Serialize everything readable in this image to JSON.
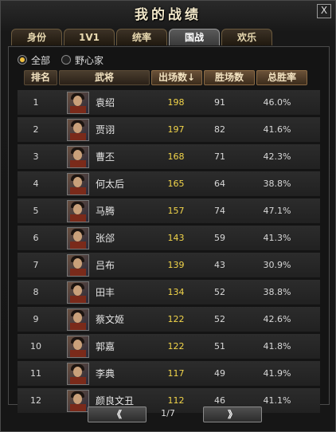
{
  "window": {
    "title": "我的战绩",
    "close_label": "X"
  },
  "tabs": [
    {
      "label": "身份",
      "active": false
    },
    {
      "label": "1V1",
      "active": false
    },
    {
      "label": "统率",
      "active": false
    },
    {
      "label": "国战",
      "active": true
    },
    {
      "label": "欢乐",
      "active": false
    }
  ],
  "filters": [
    {
      "label": "全部",
      "selected": true
    },
    {
      "label": "野心家",
      "selected": false
    }
  ],
  "columns": {
    "rank": "排名",
    "general": "武将",
    "games": "出场数",
    "games_sort_icon": "sort-down-arrow-icon",
    "wins": "胜场数",
    "win_rate": "总胜率"
  },
  "rows": [
    {
      "rank": "1",
      "name": "袁绍",
      "games": "198",
      "wins": "91",
      "rate": "46.0%"
    },
    {
      "rank": "2",
      "name": "贾诩",
      "games": "197",
      "wins": "82",
      "rate": "41.6%"
    },
    {
      "rank": "3",
      "name": "曹丕",
      "games": "168",
      "wins": "71",
      "rate": "42.3%"
    },
    {
      "rank": "4",
      "name": "何太后",
      "games": "165",
      "wins": "64",
      "rate": "38.8%"
    },
    {
      "rank": "5",
      "name": "马腾",
      "games": "157",
      "wins": "74",
      "rate": "47.1%"
    },
    {
      "rank": "6",
      "name": "张郃",
      "games": "143",
      "wins": "59",
      "rate": "41.3%"
    },
    {
      "rank": "7",
      "name": "吕布",
      "games": "139",
      "wins": "43",
      "rate": "30.9%"
    },
    {
      "rank": "8",
      "name": "田丰",
      "games": "134",
      "wins": "52",
      "rate": "38.8%"
    },
    {
      "rank": "9",
      "name": "蔡文姬",
      "games": "122",
      "wins": "52",
      "rate": "42.6%"
    },
    {
      "rank": "10",
      "name": "郭嘉",
      "games": "122",
      "wins": "51",
      "rate": "41.8%"
    },
    {
      "rank": "11",
      "name": "李典",
      "games": "117",
      "wins": "49",
      "rate": "41.9%"
    },
    {
      "rank": "12",
      "name": "颜良文丑",
      "games": "112",
      "wins": "46",
      "rate": "41.1%"
    }
  ],
  "pagination": {
    "prev_label": "《",
    "next_label": "》",
    "page": "1/7"
  },
  "colors": {
    "games_value": "#f2d54a",
    "radio_selected": "#f0c040"
  }
}
